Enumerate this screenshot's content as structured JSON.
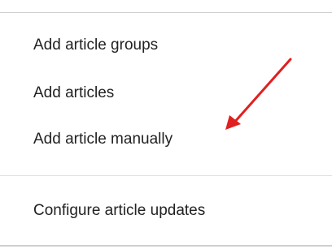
{
  "menu": {
    "items": [
      {
        "label": "Add article groups"
      },
      {
        "label": "Add articles"
      },
      {
        "label": "Add article manually"
      }
    ],
    "secondary_items": [
      {
        "label": "Configure article updates"
      }
    ]
  },
  "annotation": {
    "arrow_color": "#e02020",
    "icon": "red-arrow-annotation-icon"
  }
}
